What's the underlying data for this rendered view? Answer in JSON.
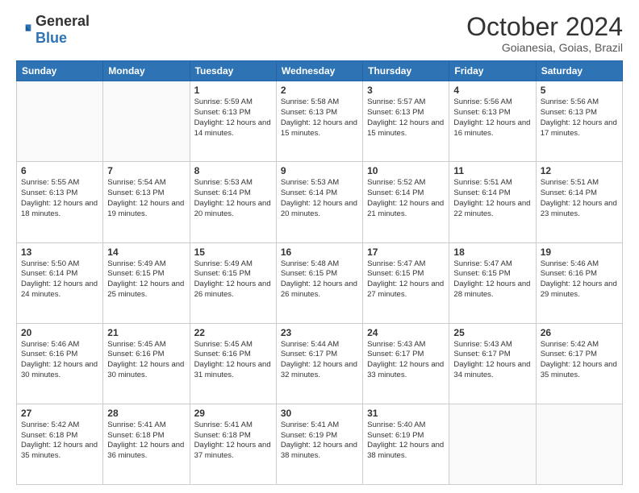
{
  "logo": {
    "text_general": "General",
    "text_blue": "Blue"
  },
  "header": {
    "month": "October 2024",
    "location": "Goianesia, Goias, Brazil"
  },
  "weekdays": [
    "Sunday",
    "Monday",
    "Tuesday",
    "Wednesday",
    "Thursday",
    "Friday",
    "Saturday"
  ],
  "weeks": [
    [
      {
        "day": "",
        "info": ""
      },
      {
        "day": "",
        "info": ""
      },
      {
        "day": "1",
        "info": "Sunrise: 5:59 AM\nSunset: 6:13 PM\nDaylight: 12 hours and 14 minutes."
      },
      {
        "day": "2",
        "info": "Sunrise: 5:58 AM\nSunset: 6:13 PM\nDaylight: 12 hours and 15 minutes."
      },
      {
        "day": "3",
        "info": "Sunrise: 5:57 AM\nSunset: 6:13 PM\nDaylight: 12 hours and 15 minutes."
      },
      {
        "day": "4",
        "info": "Sunrise: 5:56 AM\nSunset: 6:13 PM\nDaylight: 12 hours and 16 minutes."
      },
      {
        "day": "5",
        "info": "Sunrise: 5:56 AM\nSunset: 6:13 PM\nDaylight: 12 hours and 17 minutes."
      }
    ],
    [
      {
        "day": "6",
        "info": "Sunrise: 5:55 AM\nSunset: 6:13 PM\nDaylight: 12 hours and 18 minutes."
      },
      {
        "day": "7",
        "info": "Sunrise: 5:54 AM\nSunset: 6:13 PM\nDaylight: 12 hours and 19 minutes."
      },
      {
        "day": "8",
        "info": "Sunrise: 5:53 AM\nSunset: 6:14 PM\nDaylight: 12 hours and 20 minutes."
      },
      {
        "day": "9",
        "info": "Sunrise: 5:53 AM\nSunset: 6:14 PM\nDaylight: 12 hours and 20 minutes."
      },
      {
        "day": "10",
        "info": "Sunrise: 5:52 AM\nSunset: 6:14 PM\nDaylight: 12 hours and 21 minutes."
      },
      {
        "day": "11",
        "info": "Sunrise: 5:51 AM\nSunset: 6:14 PM\nDaylight: 12 hours and 22 minutes."
      },
      {
        "day": "12",
        "info": "Sunrise: 5:51 AM\nSunset: 6:14 PM\nDaylight: 12 hours and 23 minutes."
      }
    ],
    [
      {
        "day": "13",
        "info": "Sunrise: 5:50 AM\nSunset: 6:14 PM\nDaylight: 12 hours and 24 minutes."
      },
      {
        "day": "14",
        "info": "Sunrise: 5:49 AM\nSunset: 6:15 PM\nDaylight: 12 hours and 25 minutes."
      },
      {
        "day": "15",
        "info": "Sunrise: 5:49 AM\nSunset: 6:15 PM\nDaylight: 12 hours and 26 minutes."
      },
      {
        "day": "16",
        "info": "Sunrise: 5:48 AM\nSunset: 6:15 PM\nDaylight: 12 hours and 26 minutes."
      },
      {
        "day": "17",
        "info": "Sunrise: 5:47 AM\nSunset: 6:15 PM\nDaylight: 12 hours and 27 minutes."
      },
      {
        "day": "18",
        "info": "Sunrise: 5:47 AM\nSunset: 6:15 PM\nDaylight: 12 hours and 28 minutes."
      },
      {
        "day": "19",
        "info": "Sunrise: 5:46 AM\nSunset: 6:16 PM\nDaylight: 12 hours and 29 minutes."
      }
    ],
    [
      {
        "day": "20",
        "info": "Sunrise: 5:46 AM\nSunset: 6:16 PM\nDaylight: 12 hours and 30 minutes."
      },
      {
        "day": "21",
        "info": "Sunrise: 5:45 AM\nSunset: 6:16 PM\nDaylight: 12 hours and 30 minutes."
      },
      {
        "day": "22",
        "info": "Sunrise: 5:45 AM\nSunset: 6:16 PM\nDaylight: 12 hours and 31 minutes."
      },
      {
        "day": "23",
        "info": "Sunrise: 5:44 AM\nSunset: 6:17 PM\nDaylight: 12 hours and 32 minutes."
      },
      {
        "day": "24",
        "info": "Sunrise: 5:43 AM\nSunset: 6:17 PM\nDaylight: 12 hours and 33 minutes."
      },
      {
        "day": "25",
        "info": "Sunrise: 5:43 AM\nSunset: 6:17 PM\nDaylight: 12 hours and 34 minutes."
      },
      {
        "day": "26",
        "info": "Sunrise: 5:42 AM\nSunset: 6:17 PM\nDaylight: 12 hours and 35 minutes."
      }
    ],
    [
      {
        "day": "27",
        "info": "Sunrise: 5:42 AM\nSunset: 6:18 PM\nDaylight: 12 hours and 35 minutes."
      },
      {
        "day": "28",
        "info": "Sunrise: 5:41 AM\nSunset: 6:18 PM\nDaylight: 12 hours and 36 minutes."
      },
      {
        "day": "29",
        "info": "Sunrise: 5:41 AM\nSunset: 6:18 PM\nDaylight: 12 hours and 37 minutes."
      },
      {
        "day": "30",
        "info": "Sunrise: 5:41 AM\nSunset: 6:19 PM\nDaylight: 12 hours and 38 minutes."
      },
      {
        "day": "31",
        "info": "Sunrise: 5:40 AM\nSunset: 6:19 PM\nDaylight: 12 hours and 38 minutes."
      },
      {
        "day": "",
        "info": ""
      },
      {
        "day": "",
        "info": ""
      }
    ]
  ]
}
